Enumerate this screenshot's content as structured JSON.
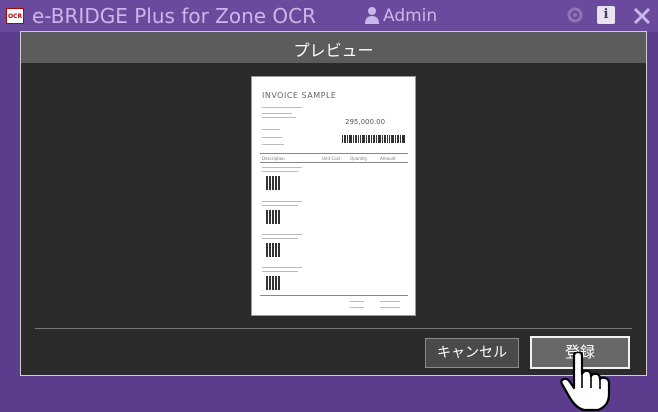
{
  "app": {
    "logo_text": "OCR",
    "title": "e-BRIDGE Plus for Zone OCR",
    "user_name": "Admin",
    "colors": {
      "header": "#6a4a9c",
      "dialog_bg": "#2b2b2b",
      "title_bar": "#5c5c5c"
    }
  },
  "dialog": {
    "title": "プレビュー",
    "preview": {
      "document_title": "INVOICE SAMPLE",
      "amount": "295,000.00",
      "column_headers": [
        "Description",
        "Unit Cost",
        "Quantity",
        "Amount"
      ]
    },
    "buttons": {
      "cancel_label": "キャンセル",
      "register_label": "登録"
    }
  },
  "icons": [
    "user-icon",
    "gear-icon",
    "info-icon",
    "close-icon",
    "hand-cursor-icon"
  ]
}
